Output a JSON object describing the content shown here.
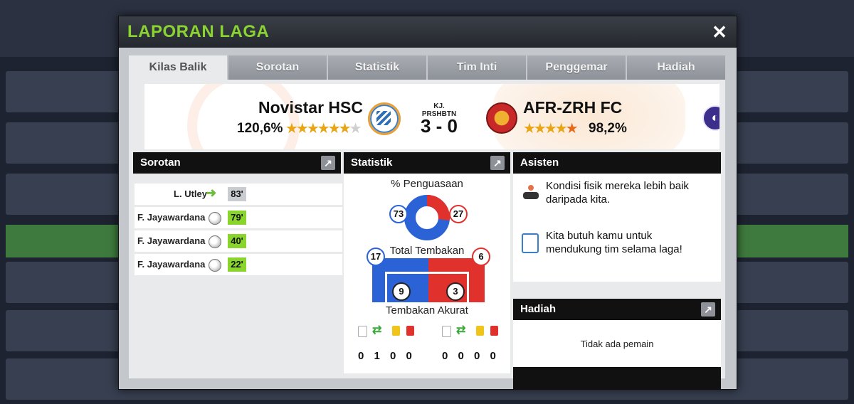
{
  "modal": {
    "title": "LAPORAN LAGA",
    "close_label": "✕"
  },
  "tabs": [
    "Kilas Balik",
    "Sorotan",
    "Statistik",
    "Tim Inti",
    "Penggemar",
    "Hadiah"
  ],
  "active_tab": "Kilas Balik",
  "match": {
    "home_team": "Novistar HSC",
    "home_rating": "120,6%",
    "home_stars": "★★★★★★",
    "home_stars_empty": "★",
    "competition": "KJ. PRSHBTN",
    "score": "3 - 0",
    "away_team": "AFR-ZRH FC",
    "away_rating": "98,2%",
    "away_stars": "★★★★",
    "away_stars_half": "★"
  },
  "highlights": {
    "title": "Sorotan",
    "items": [
      {
        "player": "L. Utley",
        "type": "substitution",
        "minute": "83'"
      },
      {
        "player": "F. Jayawardana",
        "type": "goal",
        "minute": "79'"
      },
      {
        "player": "F. Jayawardana",
        "type": "goal",
        "minute": "40'"
      },
      {
        "player": "F. Jayawardana",
        "type": "goal",
        "minute": "22'"
      }
    ]
  },
  "stats": {
    "title": "Statistik",
    "possession_label": "% Penguasaan",
    "possession_home": "73",
    "possession_away": "27",
    "total_shots_label": "Total Tembakan",
    "shots_home": "17",
    "shots_away": "6",
    "on_target_label": "Tembakan Akurat",
    "on_target_home": "9",
    "on_target_away": "3",
    "home_cards": "0 1 0 0",
    "away_cards": "0 0 0 0"
  },
  "assistant": {
    "title": "Asisten",
    "message_1": "Kondisi fisik mereka lebih baik daripada kita.",
    "message_2": "Kita butuh kamu untuk mendukung tim selama laga!"
  },
  "rewards": {
    "title": "Hadiah",
    "empty_text": "Tidak ada pemain"
  },
  "colors": {
    "home": "#2b63d6",
    "away": "#e0312d",
    "title_green": "#8bd332",
    "minute_green": "#8ad42e",
    "minute_grey": "#c9ccd1"
  }
}
